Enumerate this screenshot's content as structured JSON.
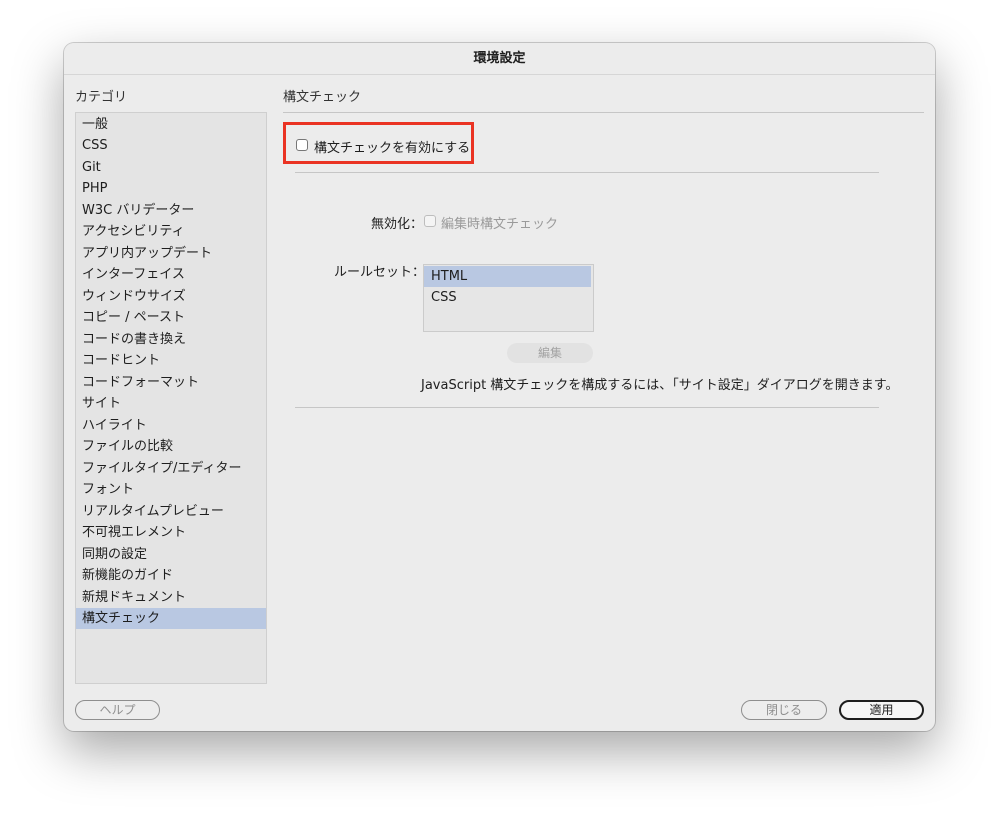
{
  "window": {
    "title": "環境設定"
  },
  "sidebar": {
    "label": "カテゴリ",
    "items": [
      {
        "label": "一般"
      },
      {
        "label": "CSS"
      },
      {
        "label": "Git"
      },
      {
        "label": "PHP"
      },
      {
        "label": "W3C バリデーター"
      },
      {
        "label": "アクセシビリティ"
      },
      {
        "label": "アプリ内アップデート"
      },
      {
        "label": "インターフェイス"
      },
      {
        "label": "ウィンドウサイズ"
      },
      {
        "label": "コピー / ペースト"
      },
      {
        "label": "コードの書き換え"
      },
      {
        "label": "コードヒント"
      },
      {
        "label": "コードフォーマット"
      },
      {
        "label": "サイト"
      },
      {
        "label": "ハイライト"
      },
      {
        "label": "ファイルの比較"
      },
      {
        "label": "ファイルタイプ/エディター"
      },
      {
        "label": "フォント"
      },
      {
        "label": "リアルタイムプレビュー"
      },
      {
        "label": "不可視エレメント"
      },
      {
        "label": "同期の設定"
      },
      {
        "label": "新機能のガイド"
      },
      {
        "label": "新規ドキュメント"
      },
      {
        "label": "構文チェック"
      }
    ],
    "selected_item": "構文チェック"
  },
  "panel": {
    "title": "構文チェック",
    "enable_checkbox": {
      "label": "構文チェックを有効にする",
      "checked": false
    },
    "disable_label": "無効化：",
    "disable_checkbox": {
      "label": "編集時構文チェック",
      "checked": false,
      "enabled": false
    },
    "ruleset_label": "ルールセット：",
    "rulesets": [
      {
        "label": "HTML"
      },
      {
        "label": "CSS"
      }
    ],
    "selected_ruleset": "HTML",
    "edit_button": "編集",
    "note": "JavaScript 構文チェックを構成するには、「サイト設定」ダイアログを開きます。"
  },
  "footer": {
    "help_button": "ヘルプ",
    "close_button": "閉じる",
    "apply_button": "適用"
  },
  "colors": {
    "selection": "#b9c8e2",
    "highlight_border": "#ea3323"
  }
}
